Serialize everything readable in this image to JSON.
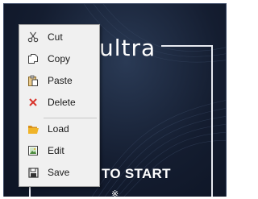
{
  "background": {
    "brand_text": "ultra",
    "cta_text": "TO START",
    "spark_glyph": "※",
    "colors": {
      "bg_dark": "#141d30",
      "line": "#e6e9f0",
      "text": "#ffffff"
    }
  },
  "context_menu": {
    "items": [
      {
        "label": "Cut",
        "icon": "scissors-icon"
      },
      {
        "label": "Copy",
        "icon": "copy-icon"
      },
      {
        "label": "Paste",
        "icon": "paste-icon"
      },
      {
        "label": "Delete",
        "icon": "delete-x-icon",
        "icon_color": "#d9342b"
      },
      {
        "label": "Load",
        "icon": "folder-open-icon",
        "icon_color": "#e8a317"
      },
      {
        "label": "Edit",
        "icon": "edit-image-icon"
      },
      {
        "label": "Save",
        "icon": "save-disk-icon"
      }
    ],
    "colors": {
      "bg": "#f0f0f0",
      "border": "#a0a0a0",
      "text": "#1a1a1a"
    }
  }
}
